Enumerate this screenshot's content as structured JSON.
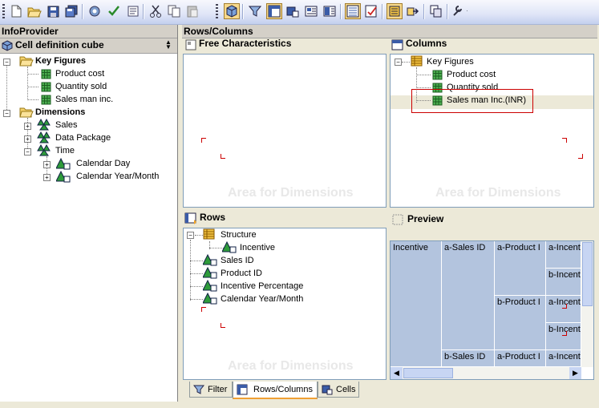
{
  "toolbar": {
    "icons": [
      "new-icon",
      "open-icon",
      "save-icon",
      "save-all-icon",
      "check-icon",
      "check-mark-icon",
      "properties-icon",
      "cut-icon",
      "copy-icon",
      "paste-icon",
      "cube-icon",
      "filter-icon",
      "rows-columns-icon",
      "cells-icon",
      "conditions-icon",
      "exceptions-icon",
      "structure-icon",
      "query-properties-icon",
      "variables-icon",
      "jump-icon",
      "copy-query-icon",
      "tools-icon"
    ]
  },
  "left_panel": {
    "title": "InfoProvider",
    "cube_label": "Cell definition cube",
    "key_figures_label": "Key Figures",
    "key_figures": [
      "Product cost",
      "Quantity sold",
      "Sales man inc."
    ],
    "dimensions_label": "Dimensions",
    "dimensions": [
      "Sales",
      "Data Package",
      "Time"
    ],
    "time_children": [
      "Calendar Day",
      "Calendar Year/Month"
    ]
  },
  "main": {
    "title": "Rows/Columns",
    "free_chars_title": "Free Characteristics",
    "columns_title": "Columns",
    "rows_title": "Rows",
    "preview_title": "Preview",
    "area_text": "Area for Dimensions",
    "columns_tree": {
      "root": "Key Figures",
      "items": [
        "Product cost",
        "Quantity sold",
        "Sales man Inc.(INR)"
      ]
    },
    "rows_tree": {
      "structure": "Structure",
      "structure_child": "Incentive",
      "items": [
        "Sales ID",
        "Product ID",
        "Incentive Percentage",
        "Calendar Year/Month"
      ]
    },
    "preview": {
      "col1": "Incentive",
      "sales_a": "a-Sales ID",
      "sales_b": "b-Sales ID",
      "prod_a": "a-Product I",
      "prod_b": "b-Product I",
      "prod_a2": "a-Product I",
      "inc_a1": "a-Incent",
      "inc_b1": "b-Incent",
      "inc_a2": "a-Incent",
      "inc_b2": "b-Incent",
      "inc_a3": "a-Incent"
    }
  },
  "tabs": [
    "Filter",
    "Rows/Columns",
    "Cells"
  ],
  "colors": {
    "highlight_box": "#cc0000",
    "preview_cell": "#b3c4de"
  }
}
